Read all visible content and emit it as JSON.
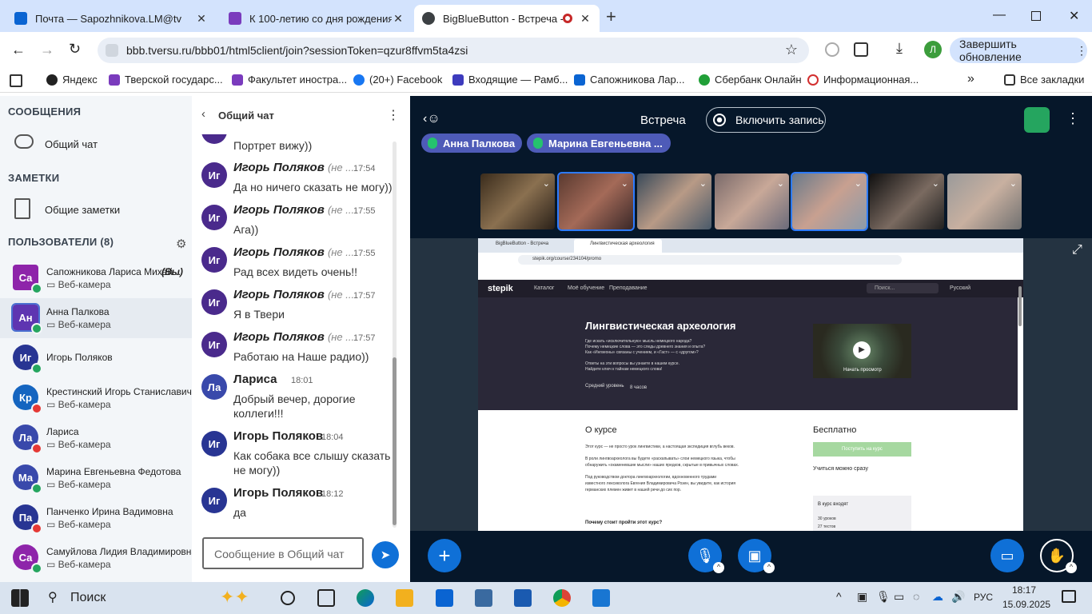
{
  "browser": {
    "tabs": [
      {
        "title": "Почта — Sapozhnikova.LM@tv",
        "color": "#0a64d2"
      },
      {
        "title": "К 100-летию со дня рождения",
        "color": "#7a3bbd"
      },
      {
        "title": "BigBlueButton - Встреча - ",
        "color": "#3c4043"
      }
    ],
    "new_tab": "+",
    "url": "bbb.tversu.ru/bbb01/html5client/join?sessionToken=qzur8ffvm5ta4zsi",
    "update_button": "Завершить обновление",
    "profile_letter": "Л",
    "bookmarks": [
      {
        "label": "Яндекс",
        "color": "#222"
      },
      {
        "label": "Тверской государс...",
        "color": "#7a3bbd"
      },
      {
        "label": "Факультет иностра...",
        "color": "#7a3bbd"
      },
      {
        "label": "(20+) Facebook",
        "color": "#1877f2"
      },
      {
        "label": "Входящие — Рамб...",
        "color": "#3d3bbd"
      },
      {
        "label": "Сапожникова Лар...",
        "color": "#0a64d2"
      },
      {
        "label": "Сбербанк Онлайн",
        "color": "#21a038"
      },
      {
        "label": "Информационная...",
        "color": "#d32f2f"
      }
    ],
    "more_bookmarks": "»",
    "all_bookmarks": "Все закладки"
  },
  "sidebar": {
    "messages_header": "СООБЩЕНИЯ",
    "public_chat": "Общий чат",
    "notes_header": "ЗАМЕТКИ",
    "shared_notes": "Общие заметки",
    "users_header": "ПОЛЬЗОВАТЕЛИ (8)",
    "users": [
      {
        "initials": "Са",
        "name": "Сапожникова Лариса Михай...",
        "you": "(Вы)",
        "status": "Веб-камера",
        "color": "#8e24aa",
        "dot": "#25a55f"
      },
      {
        "initials": "Ан",
        "name": "Анна Палкова",
        "status": "Веб-камера",
        "color": "#5e35b1",
        "dot": "#25a55f"
      },
      {
        "initials": "Иг",
        "name": "Игорь Поляков",
        "status": "",
        "color": "#283593",
        "dot": "#25a55f"
      },
      {
        "initials": "Кр",
        "name": "Крестинский Игорь Станиславич",
        "status": "Веб-камера",
        "color": "#1565c0",
        "dot": "#e53935"
      },
      {
        "initials": "Ла",
        "name": "Лариса",
        "status": "Веб-камера",
        "color": "#3949ab",
        "dot": "#e53935"
      },
      {
        "initials": "Ма",
        "name": "Марина Евгеньевна Федотова",
        "status": "Веб-камера",
        "color": "#3949ab",
        "dot": "#25a55f"
      },
      {
        "initials": "Па",
        "name": "Панченко Ирина Вадимовна",
        "status": "Веб-камера",
        "color": "#283593",
        "dot": "#e53935"
      },
      {
        "initials": "Са",
        "name": "Самуйлова Лидия Владимировна",
        "status": "Веб-камера",
        "color": "#8e24aa",
        "dot": "#25a55f"
      }
    ]
  },
  "chat": {
    "title": "Общий чат",
    "first_partial": "Портрет вижу))",
    "messages": [
      {
        "initials": "Иг",
        "name": "Игорь Поляков",
        "suffix": "(не ...",
        "time": "17:54",
        "text": "Да но ничего сказать не могу))",
        "color": "#4a2a8c"
      },
      {
        "initials": "Иг",
        "name": "Игорь Поляков",
        "suffix": "(не ...",
        "time": "17:55",
        "text": "Ага))",
        "color": "#4a2a8c"
      },
      {
        "initials": "Иг",
        "name": "Игорь Поляков",
        "suffix": "(не ...",
        "time": "17:55",
        "text": "Рад всех видеть очень!!",
        "color": "#4a2a8c"
      },
      {
        "initials": "Иг",
        "name": "Игорь Поляков",
        "suffix": "(не ...",
        "time": "17:57",
        "text": "Я в Твери",
        "color": "#4a2a8c"
      },
      {
        "initials": "Иг",
        "name": "Игорь Поляков",
        "suffix": "(не ...",
        "time": "17:57",
        "text": "Работаю на Наше радио))",
        "color": "#4a2a8c"
      },
      {
        "initials": "Ла",
        "name": "Лариса",
        "suffix": "",
        "time": "18:01",
        "text": "Добрый вечер, дорогие коллеги!!!",
        "color": "#3949ab"
      },
      {
        "initials": "Иг",
        "name": "Игорь Поляков",
        "suffix": "",
        "time": "18:04",
        "text": "Как собака все слышу сказать не могу))",
        "color": "#283593"
      },
      {
        "initials": "Иг",
        "name": "Игорь Поляков",
        "suffix": "",
        "time": "18:12",
        "text": "да",
        "color": "#283593"
      }
    ],
    "input_placeholder": "Сообщение в Общий чат"
  },
  "meeting": {
    "title": "Встреча",
    "record_button": "Включить запись",
    "talkers": [
      "Анна Палкова",
      "Марина Евгеньевна ..."
    ],
    "thumb_colors": [
      "#6d5a3c",
      "#3a3030",
      "#4a5a6a",
      "#8a7a7a",
      "#6a7a8a",
      "#222222",
      "#8a8a8a"
    ]
  },
  "slide": {
    "tabs": [
      "BigBlueButton - Встреча",
      "Лингвистическая археология"
    ],
    "url": "stepik.org/course/234104/promo",
    "site": "stepik",
    "nav": [
      "Каталог",
      "Моё обучение",
      "Преподавание"
    ],
    "search": "Поиск...",
    "lang": "Русский",
    "course_title": "Лингвистическая археология",
    "course_lines": [
      "Где искать «исключительную» мысль немецкого народа?",
      "Почему немецкие слова — это следы древнего знания и опыта?",
      "Как «Ингвеоны» связаны с учением, и «Гаст» — с «другом»?",
      "Ответы на эти вопросы вы узнаете в нашем курсе.",
      "Найдите ключ к тайнам немецкого слова!"
    ],
    "level": "Средний уровень",
    "hours": "8 часов",
    "video_label": "Начать просмотр",
    "about_header": "О курсе",
    "about_lines": [
      "Этот курс — не просто урок лингвистики, а настоящая экспедиция вглубь веков.",
      "В роли лингвоархеолога вы будете «раскапывать» слои немецкого языка, чтобы",
      "обнаружить «окаменевшие мысли» наших предков, скрытые в привычных словах.",
      "Под руководством доктора лингвоархеологии, вдохновенного трудами",
      "известного лексиколога Евгения Владимировича Розен, вы увидите, как история",
      "германских племен живет в нашей речи до сих пор."
    ],
    "why_header": "Почему стоит пройти этот курс?",
    "price": "Бесплатно",
    "enroll": "Поступить на курс",
    "start_now": "Учиться можно сразу",
    "includes": "В курс входят",
    "lessons": "30 уроков",
    "tests": "27 тестов"
  },
  "taskbar": {
    "search": "Поиск",
    "lang": "РУС",
    "time": "18:17",
    "date": "15.09.2025"
  }
}
